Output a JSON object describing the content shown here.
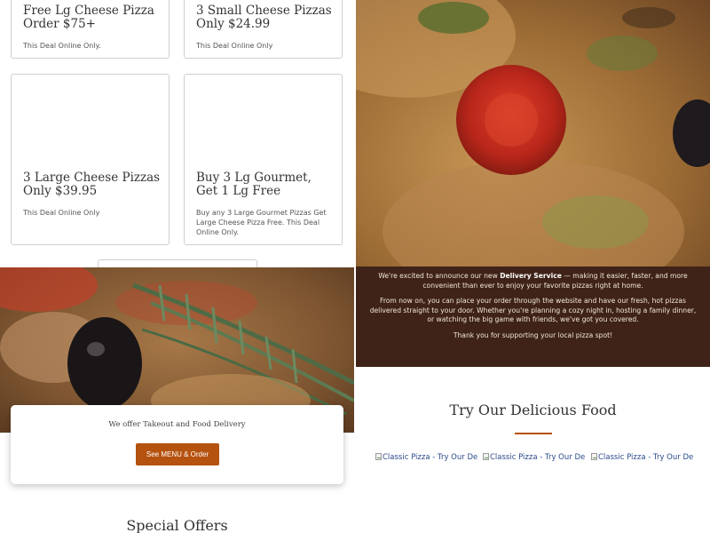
{
  "deals": [
    {
      "title": "Free Lg Cheese Pizza Order $75+",
      "desc": "This Deal Online Only."
    },
    {
      "title": "3 Small Cheese Pizzas Only $24.99",
      "desc": "This Deal Online Only"
    },
    {
      "title": "3 Large Cheese Pizzas Only $39.95",
      "desc": "This Deal Online Only"
    },
    {
      "title": "Buy 3 Lg Gourmet, Get 1 Lg Free",
      "desc": "Buy any 3 Large Gourmet Pizzas Get Large Cheese Pizza Free. This Deal Online Only."
    }
  ],
  "announcement": {
    "p1_before": "We're excited to announce our new ",
    "p1_bold": "Delivery Service",
    "p1_after": " — making it easier, faster, and more convenient than ever to enjoy your favorite pizzas right at home.",
    "p2": "From now on, you can place your order through the website and have our fresh, hot pizzas delivered straight to your door. Whether you're planning a cozy night in, hosting a family dinner, or watching the big game with friends, we've got you covered.",
    "p3": "Thank you for supporting your local pizza spot!"
  },
  "takeout": {
    "text": "We offer Takeout and Food Delivery",
    "button": "See MENU & Order"
  },
  "food": {
    "heading": "Try Our Delicious Food",
    "images": [
      {
        "alt": "Classic Pizza - Try Our Delic"
      },
      {
        "alt": "Classic Pizza - Try Our Delic"
      },
      {
        "alt": "Classic Pizza - Try Our Delic"
      }
    ]
  },
  "special_offers": {
    "heading": "Special Offers"
  },
  "colors": {
    "accent": "#b5520f",
    "announce_bg": "#3f2318"
  }
}
